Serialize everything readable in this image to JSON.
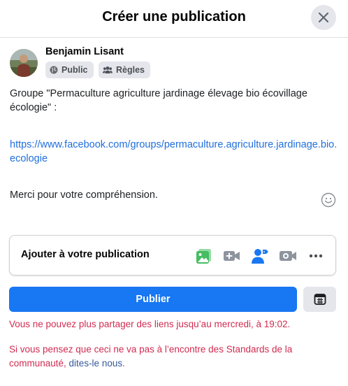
{
  "header": {
    "title": "Créer une publication",
    "close_icon": "close-icon"
  },
  "author": {
    "name": "Benjamin Lisant",
    "audience_label": "Public",
    "audience_icon": "globe-icon",
    "rules_label": "Règles",
    "rules_icon": "group-icon"
  },
  "post": {
    "line1": "Groupe \"Permaculture agriculture jardinage élevage bio écovillage écologie\" :",
    "link": "https://www.facebook.com/groups/permaculture.agriculture.jardinage.bio.ecologie",
    "line3": "Merci pour votre compréhension."
  },
  "add_to_post": {
    "label": "Ajouter à votre publication",
    "icons": [
      "photo-video-icon",
      "gif-video-icon",
      "tag-people-icon",
      "live-video-icon",
      "more-icon"
    ]
  },
  "actions": {
    "publish_label": "Publier",
    "schedule_icon": "calendar-icon"
  },
  "errors": {
    "line1": "Vous ne pouvez plus partager des liens jusqu’au mercredi, à 19:02.",
    "line2_prefix": "Si vous pensez que ceci ne va pas à l’encontre des Standards de la communauté, ",
    "line2_link": "dites-le nous",
    "line2_suffix": "."
  },
  "colors": {
    "primary": "#1877f2",
    "link": "#216fdb",
    "error": "#d02c50",
    "photo_green": "#45bd62",
    "tag_blue": "#1877f2",
    "icon_grey": "#8d949e"
  }
}
